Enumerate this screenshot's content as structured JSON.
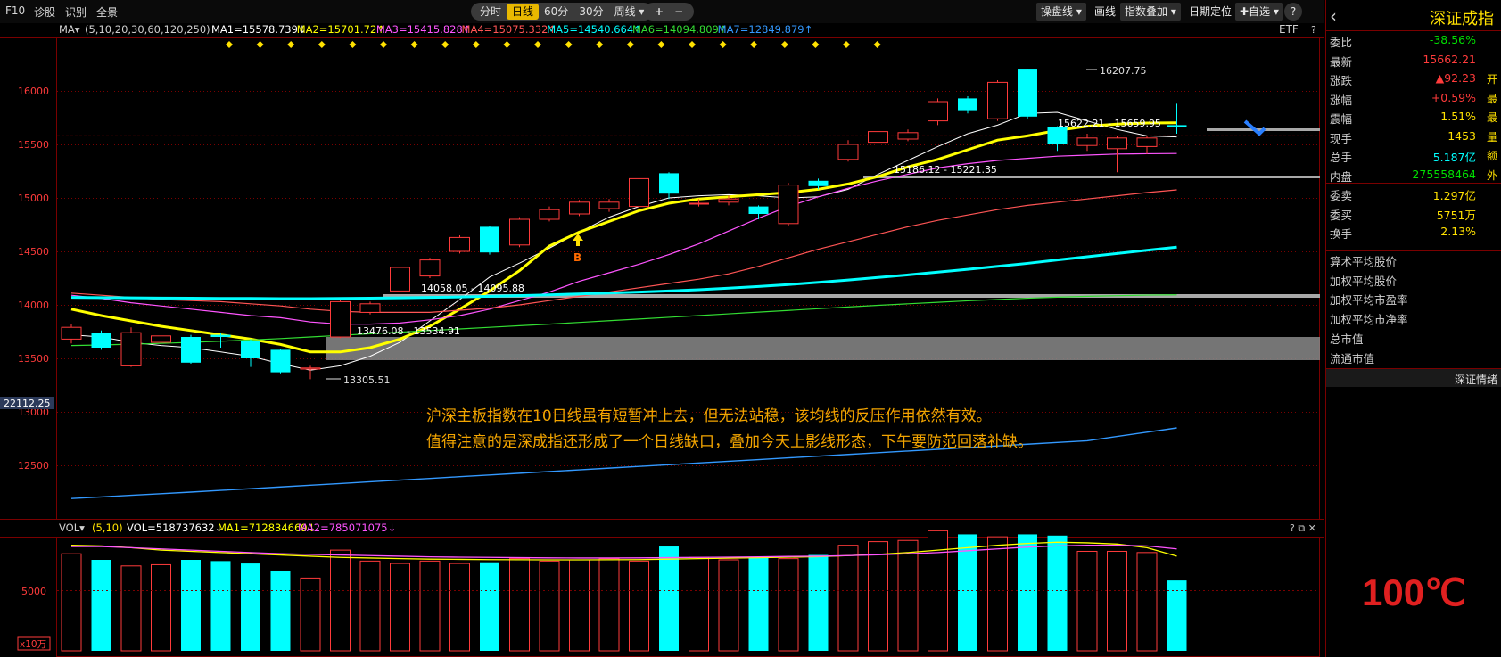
{
  "menu": [
    "F10",
    "诊股",
    "识别",
    "全景"
  ],
  "periods": [
    "分时",
    "日线",
    "60分",
    "30分",
    "周线 ▾"
  ],
  "zoom": [
    "+",
    "−"
  ],
  "tools": [
    "操盘线 ▾",
    "画线",
    "指数叠加 ▾",
    "日期定位",
    "✚自选 ▾"
  ],
  "help_icon": "?",
  "ma_legend": {
    "prefix": "MA▾",
    "params": "(5,10,20,30,60,120,250)",
    "items": [
      {
        "text": "MA1=15578.739↓",
        "color": "#ffffff"
      },
      {
        "text": "MA2=15701.72↑",
        "color": "#ffff00"
      },
      {
        "text": "MA3=15415.828↑",
        "color": "#ff55ff"
      },
      {
        "text": "MA4=15075.332↑",
        "color": "#ff5555"
      },
      {
        "text": "MA5=14540.664↑",
        "color": "#00ffff"
      },
      {
        "text": "MA6=14094.809↑",
        "color": "#33dd33"
      },
      {
        "text": "MA7=12849.879↑",
        "color": "#3399ff"
      }
    ],
    "etf": "ETF",
    "q": "?"
  },
  "price_axis": [
    "16000",
    "15500",
    "15000",
    "14500",
    "14000",
    "13500",
    "13000",
    "12500"
  ],
  "current_price_tag": "22112.25",
  "price_labels": {
    "high": "16207.75",
    "low": "13305.51",
    "gap1": "15186.12 - 15221.35",
    "gap2": "15622.21 - 15659.95",
    "gap3": "14058.05 - 14095.88",
    "gap4": "13476.08 - 13534.91",
    "b_marker": "B"
  },
  "note_lines": [
    "沪深主板指数在10日线虽有短暂冲上去，但无法站稳，该均线的反压作用依然有效。",
    "值得注意的是深成指还形成了一个日线缺口，叠加今天上影线形态，下午要防范回落补缺。"
  ],
  "vol_legend": {
    "prefix": "VOL▾",
    "params": "(5,10)",
    "vol": "VOL=518737632↓",
    "ma1": "MA1=712834669↓",
    "ma2": "MA2=785071075↓",
    "icons": "? ⧉ ✕"
  },
  "vol_axis": [
    "5000"
  ],
  "vol_unit": "x10万",
  "chart_data": {
    "type": "candlestick",
    "candles": [
      {
        "o": 13680,
        "c": 13790,
        "h": 13820,
        "l": 13640
      },
      {
        "o": 13740,
        "c": 13600,
        "h": 13760,
        "l": 13580
      },
      {
        "o": 13430,
        "c": 13740,
        "h": 13790,
        "l": 13420
      },
      {
        "o": 13650,
        "c": 13710,
        "h": 13740,
        "l": 13570
      },
      {
        "o": 13700,
        "c": 13460,
        "h": 13720,
        "l": 13450
      },
      {
        "o": 13720,
        "c": 13700,
        "h": 13740,
        "l": 13600
      },
      {
        "o": 13660,
        "c": 13500,
        "h": 13680,
        "l": 13420
      },
      {
        "o": 13580,
        "c": 13370,
        "h": 13590,
        "l": 13360
      },
      {
        "o": 13400,
        "c": 13410,
        "h": 13430,
        "l": 13305.51
      },
      {
        "o": 13700,
        "c": 14030,
        "h": 14050,
        "l": 13690
      },
      {
        "o": 13930,
        "c": 14010,
        "h": 14030,
        "l": 13910
      },
      {
        "o": 14130,
        "c": 14350,
        "h": 14380,
        "l": 14100
      },
      {
        "o": 14270,
        "c": 14420,
        "h": 14440,
        "l": 14250
      },
      {
        "o": 14500,
        "c": 14630,
        "h": 14650,
        "l": 14480
      },
      {
        "o": 14730,
        "c": 14490,
        "h": 14740,
        "l": 14470
      },
      {
        "o": 14560,
        "c": 14800,
        "h": 14820,
        "l": 14540
      },
      {
        "o": 14800,
        "c": 14890,
        "h": 14920,
        "l": 14780
      },
      {
        "o": 14850,
        "c": 14960,
        "h": 14980,
        "l": 14830
      },
      {
        "o": 14900,
        "c": 14960,
        "h": 14990,
        "l": 14870
      },
      {
        "o": 14920,
        "c": 15180,
        "h": 15200,
        "l": 14900
      },
      {
        "o": 15230,
        "c": 15040,
        "h": 15240,
        "l": 14990
      },
      {
        "o": 14950,
        "c": 14950,
        "h": 14990,
        "l": 14920
      },
      {
        "o": 14960,
        "c": 14990,
        "h": 15020,
        "l": 14930
      },
      {
        "o": 14920,
        "c": 14850,
        "h": 14930,
        "l": 14800
      },
      {
        "o": 14760,
        "c": 15120,
        "h": 15140,
        "l": 14740
      },
      {
        "o": 15160,
        "c": 15110,
        "h": 15180,
        "l": 15080
      },
      {
        "o": 15360,
        "c": 15500,
        "h": 15540,
        "l": 15340
      },
      {
        "o": 15520,
        "c": 15620,
        "h": 15650,
        "l": 15500
      },
      {
        "o": 15550,
        "c": 15610,
        "h": 15640,
        "l": 15530
      },
      {
        "o": 15720,
        "c": 15900,
        "h": 15930,
        "l": 15680
      },
      {
        "o": 15930,
        "c": 15820,
        "h": 15950,
        "l": 15790
      },
      {
        "o": 15740,
        "c": 16080,
        "h": 16100,
        "l": 15720
      },
      {
        "o": 16207.75,
        "c": 15760,
        "h": 16207.75,
        "l": 15740
      },
      {
        "o": 15660,
        "c": 15500,
        "h": 15670,
        "l": 15440
      },
      {
        "o": 15490,
        "c": 15560,
        "h": 15600,
        "l": 15440
      },
      {
        "o": 15460,
        "c": 15560,
        "h": 15580,
        "l": 15240
      },
      {
        "o": 15480,
        "c": 15560,
        "h": 15580,
        "l": 15410
      },
      {
        "o": 15680,
        "c": 15662.21,
        "h": 15880,
        "l": 15600
      }
    ],
    "ma_lines": [
      {
        "name": "MA1",
        "color": "#ffffff",
        "values": [
          13720,
          13700,
          13650,
          13620,
          13600,
          13560,
          13520,
          13450,
          13390,
          13430,
          13520,
          13650,
          13850,
          14050,
          14260,
          14390,
          14530,
          14680,
          14820,
          14920,
          15000,
          15020,
          15030,
          15020,
          15000,
          15010,
          15080,
          15220,
          15350,
          15480,
          15600,
          15680,
          15790,
          15800,
          15720,
          15640,
          15580,
          15570
        ]
      },
      {
        "name": "MA2",
        "color": "#ffff00",
        "values": [
          13960,
          13900,
          13850,
          13800,
          13760,
          13720,
          13680,
          13630,
          13560,
          13560,
          13600,
          13680,
          13800,
          13960,
          14130,
          14320,
          14550,
          14680,
          14780,
          14880,
          14950,
          14990,
          15010,
          15030,
          15050,
          15080,
          15130,
          15200,
          15290,
          15360,
          15450,
          15540,
          15580,
          15630,
          15670,
          15690,
          15700,
          15702
        ]
      },
      {
        "name": "MA3",
        "color": "#ff55ff",
        "values": [
          14090,
          14060,
          14020,
          13990,
          13960,
          13930,
          13900,
          13880,
          13840,
          13820,
          13820,
          13830,
          13860,
          13900,
          13960,
          14040,
          14120,
          14220,
          14300,
          14380,
          14470,
          14570,
          14690,
          14810,
          14920,
          15010,
          15090,
          15160,
          15220,
          15280,
          15320,
          15350,
          15370,
          15390,
          15400,
          15410,
          15413,
          15415
        ]
      },
      {
        "name": "MA4",
        "color": "#ff5555",
        "values": [
          14110,
          14090,
          14070,
          14050,
          14040,
          14030,
          14010,
          13990,
          13960,
          13940,
          13930,
          13930,
          13930,
          13950,
          13970,
          14000,
          14040,
          14080,
          14120,
          14160,
          14200,
          14240,
          14290,
          14360,
          14440,
          14520,
          14590,
          14660,
          14730,
          14790,
          14840,
          14890,
          14930,
          14960,
          14990,
          15020,
          15050,
          15075
        ]
      },
      {
        "name": "MA5",
        "color": "#00ffff",
        "values": [
          14070,
          14068,
          14066,
          14064,
          14062,
          14060,
          14060,
          14058,
          14058,
          14060,
          14062,
          14066,
          14070,
          14074,
          14080,
          14086,
          14094,
          14102,
          14110,
          14120,
          14130,
          14142,
          14156,
          14172,
          14190,
          14210,
          14232,
          14256,
          14280,
          14306,
          14332,
          14360,
          14388,
          14420,
          14450,
          14480,
          14510,
          14540
        ]
      },
      {
        "name": "MA6",
        "color": "#33dd33",
        "values": [
          13620,
          13625,
          13632,
          13640,
          13650,
          13660,
          13672,
          13685,
          13700,
          13715,
          13730,
          13745,
          13760,
          13775,
          13790,
          13805,
          13820,
          13836,
          13852,
          13868,
          13884,
          13900,
          13916,
          13932,
          13948,
          13964,
          13980,
          13996,
          14010,
          14024,
          14038,
          14050,
          14062,
          14072,
          14080,
          14086,
          14091,
          14094
        ]
      },
      {
        "name": "MA7",
        "color": "#3399ff",
        "values": [
          12190,
          12205,
          12220,
          12235,
          12250,
          12266,
          12282,
          12298,
          12314,
          12330,
          12346,
          12362,
          12378,
          12394,
          12410,
          12426,
          12442,
          12458,
          12474,
          12490,
          12506,
          12522,
          12538,
          12554,
          12570,
          12586,
          12602,
          12618,
          12634,
          12650,
          12666,
          12682,
          12698,
          12714,
          12730,
          12770,
          12810,
          12850
        ]
      }
    ],
    "volume": [
      8000,
      7500,
      7000,
      7100,
      7500,
      7400,
      7200,
      6600,
      6000,
      8300,
      7400,
      7200,
      7400,
      7200,
      7300,
      7600,
      7400,
      7500,
      7600,
      7400,
      8600,
      7700,
      7500,
      7700,
      7600,
      7900,
      8700,
      9000,
      9100,
      9900,
      9600,
      9400,
      9600,
      9500,
      8200,
      8200,
      8100,
      5800
    ],
    "volume_ma1": [
      8700,
      8650,
      8500,
      8300,
      8200,
      8100,
      8000,
      7900,
      7800,
      7700,
      7650,
      7600,
      7560,
      7540,
      7520,
      7510,
      7500,
      7500,
      7510,
      7520,
      7560,
      7600,
      7640,
      7680,
      7720,
      7760,
      7850,
      7950,
      8100,
      8300,
      8500,
      8700,
      8850,
      8950,
      8900,
      8800,
      8500,
      7800
    ],
    "volume_ma2": [
      8600,
      8600,
      8500,
      8400,
      8300,
      8200,
      8100,
      8000,
      7950,
      7900,
      7850,
      7800,
      7750,
      7720,
      7700,
      7680,
      7660,
      7650,
      7650,
      7660,
      7680,
      7700,
      7720,
      7750,
      7780,
      7800,
      7850,
      7920,
      8000,
      8100,
      8250,
      8400,
      8550,
      8650,
      8700,
      8700,
      8650,
      8400
    ]
  },
  "sidebar": {
    "title": "深证成指",
    "rows": [
      {
        "k": "委比",
        "v": "-38.56%",
        "vc": "#00e000",
        "u": ""
      },
      {
        "k": "最新",
        "v": "15662.21",
        "vc": "#ff3b3b",
        "u": ""
      },
      {
        "k": "涨跌",
        "v": "▲92.23",
        "vc": "#ff3b3b",
        "u": "开"
      },
      {
        "k": "涨幅",
        "v": "+0.59%",
        "vc": "#ff3b3b",
        "u": "最"
      },
      {
        "k": "震幅",
        "v": "1.51%",
        "vc": "#ffe100",
        "u": "最"
      },
      {
        "k": "现手",
        "v": "1453",
        "vc": "#ffe100",
        "u": "量"
      },
      {
        "k": "总手",
        "v": "5.187亿",
        "vc": "#00ffff",
        "u": "额"
      },
      {
        "k": "内盘",
        "v": "275558464",
        "vc": "#00e000",
        "u": "外"
      },
      {
        "k": "委卖",
        "v": "1.297亿",
        "vc": "#ffe100",
        "u": ""
      },
      {
        "k": "委买",
        "v": "5751万",
        "vc": "#ffe100",
        "u": ""
      },
      {
        "k": "换手",
        "v": "2.13%",
        "vc": "#ffe100",
        "u": ""
      }
    ],
    "extra": [
      "算术平均股价",
      "加权平均股价",
      "加权平均市盈率",
      "加权平均市净率",
      "总市值",
      "流通市值"
    ],
    "banner": "深证情绪",
    "temp": "100℃"
  }
}
